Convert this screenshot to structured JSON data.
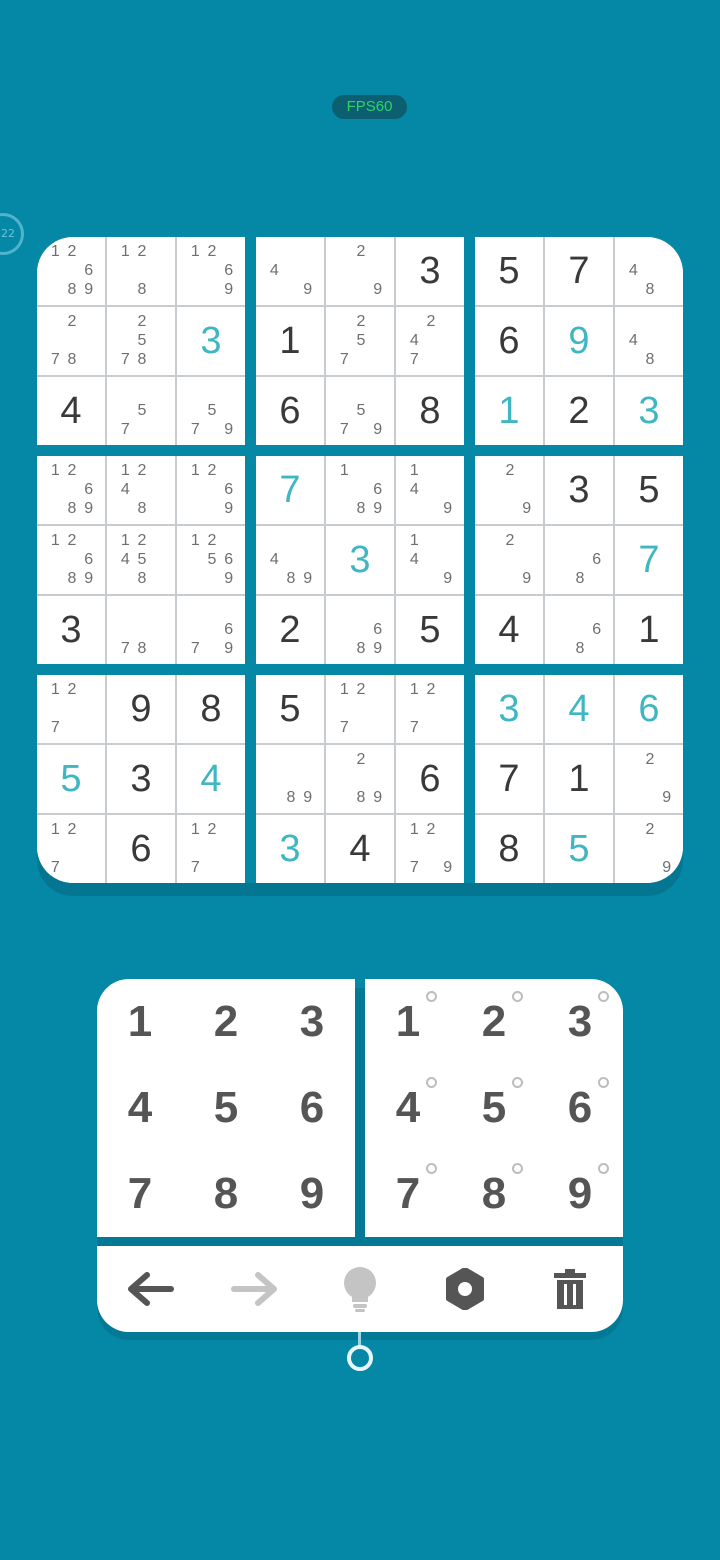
{
  "fps_label": "FPS60",
  "timer_label": "22",
  "board": [
    [
      {
        "n": [
          "1",
          "2",
          "6",
          "8",
          "9"
        ]
      },
      {
        "n": [
          "1",
          "2",
          "8"
        ]
      },
      {
        "n": [
          "1",
          "2",
          "6",
          "9"
        ]
      },
      {
        "n": [
          "4",
          "9"
        ]
      },
      {
        "n": [
          "2",
          "9"
        ]
      },
      {
        "v": "3"
      },
      {
        "v": "5"
      },
      {
        "v": "7"
      },
      {
        "n": [
          "4",
          "8"
        ]
      }
    ],
    [
      {
        "n": [
          "2",
          "7",
          "8"
        ]
      },
      {
        "n": [
          "2",
          "5",
          "7",
          "8"
        ]
      },
      {
        "v": "3",
        "u": true
      },
      {
        "v": "1"
      },
      {
        "n": [
          "2",
          "5",
          "7"
        ]
      },
      {
        "n": [
          "2",
          "4",
          "7"
        ]
      },
      {
        "v": "6"
      },
      {
        "v": "9",
        "u": true
      },
      {
        "n": [
          "4",
          "8"
        ]
      }
    ],
    [
      {
        "v": "4"
      },
      {
        "n": [
          "5",
          "7"
        ]
      },
      {
        "n": [
          "5",
          "7",
          "9"
        ]
      },
      {
        "v": "6"
      },
      {
        "n": [
          "5",
          "7",
          "9"
        ]
      },
      {
        "v": "8"
      },
      {
        "v": "1",
        "u": true
      },
      {
        "v": "2"
      },
      {
        "v": "3",
        "u": true
      }
    ],
    [
      {
        "n": [
          "1",
          "2",
          "6",
          "8",
          "9"
        ]
      },
      {
        "n": [
          "1",
          "2",
          "4",
          "8"
        ]
      },
      {
        "n": [
          "1",
          "2",
          "6",
          "9"
        ]
      },
      {
        "v": "7",
        "u": true
      },
      {
        "n": [
          "1",
          "6",
          "8",
          "9"
        ]
      },
      {
        "n": [
          "1",
          "4",
          "9"
        ]
      },
      {
        "n": [
          "2",
          "9"
        ]
      },
      {
        "v": "3"
      },
      {
        "v": "5"
      }
    ],
    [
      {
        "n": [
          "1",
          "2",
          "6",
          "8",
          "9"
        ]
      },
      {
        "n": [
          "1",
          "2",
          "4",
          "5",
          "8"
        ]
      },
      {
        "n": [
          "1",
          "2",
          "5",
          "6",
          "9"
        ]
      },
      {
        "n": [
          "4",
          "8",
          "9"
        ]
      },
      {
        "v": "3",
        "u": true
      },
      {
        "n": [
          "1",
          "4",
          "9"
        ]
      },
      {
        "n": [
          "2",
          "9"
        ]
      },
      {
        "n": [
          "6",
          "8"
        ]
      },
      {
        "v": "7",
        "u": true
      }
    ],
    [
      {
        "v": "3"
      },
      {
        "n": [
          "7",
          "8"
        ]
      },
      {
        "n": [
          "6",
          "7",
          "9"
        ]
      },
      {
        "v": "2"
      },
      {
        "n": [
          "6",
          "8",
          "9"
        ]
      },
      {
        "v": "5"
      },
      {
        "v": "4"
      },
      {
        "n": [
          "6",
          "8"
        ]
      },
      {
        "v": "1"
      }
    ],
    [
      {
        "n": [
          "1",
          "2",
          "7"
        ]
      },
      {
        "v": "9"
      },
      {
        "v": "8"
      },
      {
        "v": "5"
      },
      {
        "n": [
          "1",
          "2",
          "7"
        ]
      },
      {
        "n": [
          "1",
          "2",
          "7"
        ]
      },
      {
        "v": "3",
        "u": true
      },
      {
        "v": "4",
        "u": true
      },
      {
        "v": "6",
        "u": true
      }
    ],
    [
      {
        "v": "5",
        "u": true
      },
      {
        "v": "3"
      },
      {
        "v": "4",
        "u": true
      },
      {
        "n": [
          "8",
          "9"
        ]
      },
      {
        "n": [
          "2",
          "8",
          "9"
        ]
      },
      {
        "v": "6"
      },
      {
        "v": "7"
      },
      {
        "v": "1"
      },
      {
        "n": [
          "2",
          "9"
        ]
      }
    ],
    [
      {
        "n": [
          "1",
          "2",
          "7"
        ]
      },
      {
        "v": "6"
      },
      {
        "n": [
          "1",
          "2",
          "7"
        ]
      },
      {
        "v": "3",
        "u": true
      },
      {
        "v": "4"
      },
      {
        "n": [
          "1",
          "2",
          "7",
          "9"
        ]
      },
      {
        "v": "8"
      },
      {
        "v": "5",
        "u": true
      },
      {
        "n": [
          "2",
          "9"
        ]
      }
    ]
  ],
  "number_pad": [
    "1",
    "2",
    "3",
    "4",
    "5",
    "6",
    "7",
    "8",
    "9"
  ],
  "notes_pad": [
    "1",
    "2",
    "3",
    "4",
    "5",
    "6",
    "7",
    "8",
    "9"
  ],
  "toolbar": {
    "undo_icon": "arrow-left-icon",
    "redo_icon": "arrow-right-icon",
    "hint_icon": "lightbulb-icon",
    "settings_icon": "gear-icon",
    "erase_icon": "trash-icon"
  },
  "colors": {
    "background": "#0587a6",
    "user_digit": "#3fb6c2",
    "given_digit": "#393939",
    "fps_text": "#2fd36a"
  }
}
